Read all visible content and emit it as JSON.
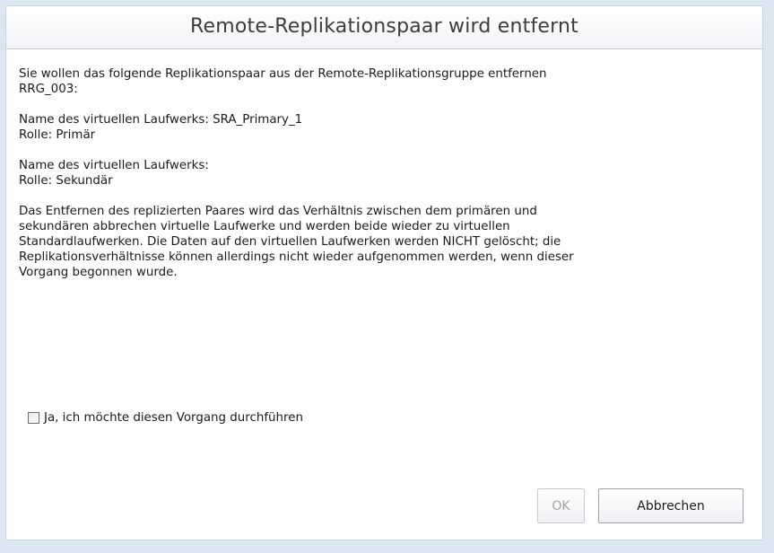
{
  "dialog": {
    "title": "Remote-Replikationspaar wird entfernt",
    "intro_line1": "Sie wollen das folgende Replikationspaar aus der Remote-Replikationsgruppe entfernen",
    "intro_line2": "RRG_003:",
    "primary": {
      "name_line": "Name des virtuellen Laufwerks: SRA_Primary_1",
      "role_line": "Rolle: Primär"
    },
    "secondary": {
      "name_line": "Name des virtuellen Laufwerks:",
      "role_line": "Rolle: Sekundär"
    },
    "warning_lines": [
      "Das Entfernen des replizierten Paares wird das Verhältnis zwischen dem primären und",
      "sekundären abbrechen virtuelle Laufwerke und werden beide wieder zu virtuellen",
      "Standardlaufwerken. Die Daten auf den virtuellen Laufwerken werden NICHT gelöscht; die",
      "Replikationsverhältnisse können allerdings nicht wieder aufgenommen werden, wenn dieser",
      "Vorgang begonnen wurde."
    ],
    "confirm_checkbox_label": "Ja, ich möchte diesen Vorgang durchführen",
    "confirm_checked": false,
    "ok_label": "OK",
    "ok_enabled": false,
    "cancel_label": "Abbrechen"
  }
}
